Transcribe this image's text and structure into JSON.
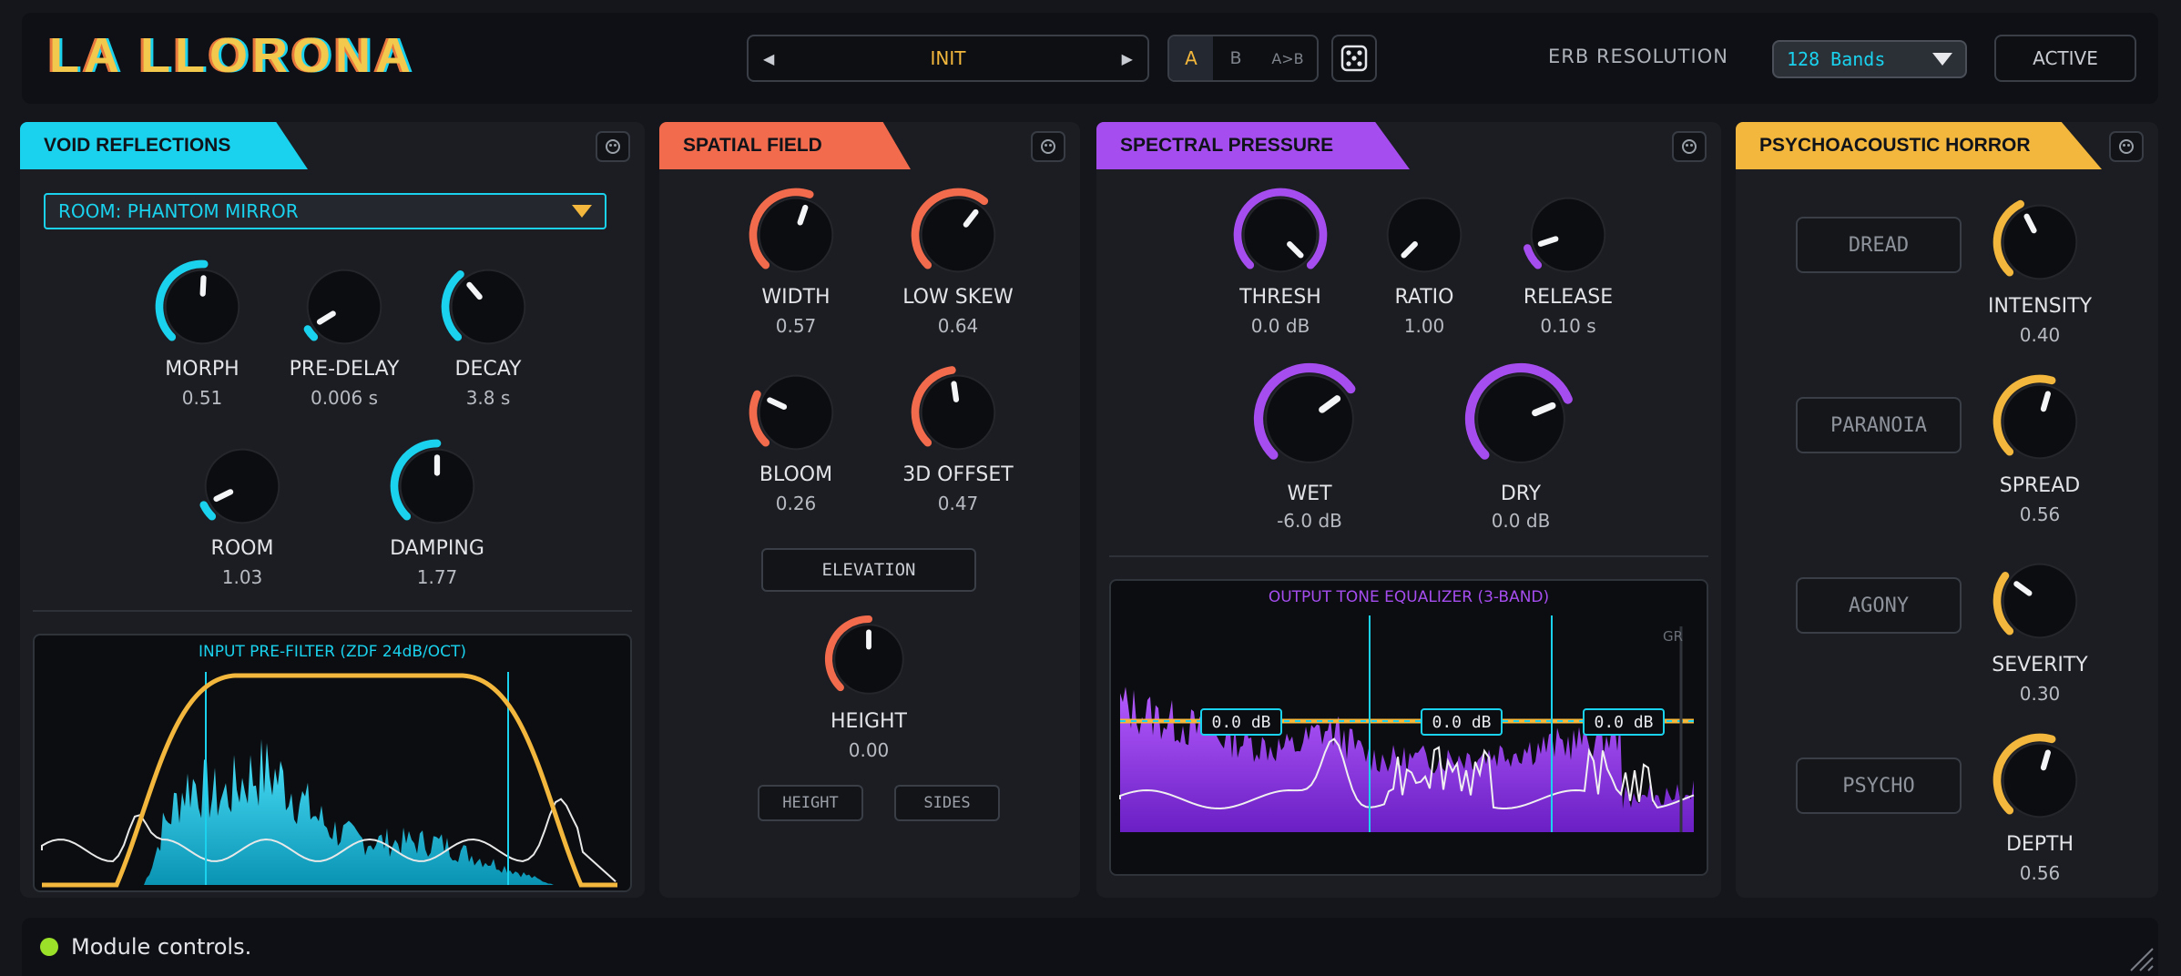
{
  "header": {
    "title": "LA LLORONA",
    "preset": {
      "prev": "◀",
      "name": "INIT",
      "next": "▶"
    },
    "ab": {
      "a": "A",
      "b": "B",
      "copy": "A>B",
      "selected": "A"
    },
    "erb_label": "ERB RESOLUTION",
    "erb_value": "128 Bands",
    "active_label": "ACTIVE"
  },
  "void": {
    "title": "VOID REFLECTIONS",
    "color": "#1ad2ee",
    "room_select": "ROOM: PHANTOM MIRROR",
    "knobs": [
      {
        "label": "MORPH",
        "value": "0.51",
        "level": 0.51
      },
      {
        "label": "PRE-DELAY",
        "value": "0.006 s",
        "level": 0.05
      },
      {
        "label": "DECAY",
        "value": "3.8 s",
        "level": 0.35
      },
      {
        "label": "ROOM",
        "value": "1.03",
        "level": 0.07
      },
      {
        "label": "DAMPING",
        "value": "1.77",
        "level": 0.5
      }
    ],
    "graph_title": "INPUT PRE-FILTER (ZDF 24dB/OCT)"
  },
  "spatial": {
    "title": "SPATIAL FIELD",
    "color": "#f26b4c",
    "knobs": [
      {
        "label": "WIDTH",
        "value": "0.57",
        "level": 0.57
      },
      {
        "label": "LOW SKEW",
        "value": "0.64",
        "level": 0.64
      },
      {
        "label": "BLOOM",
        "value": "0.26",
        "level": 0.26
      },
      {
        "label": "3D OFFSET",
        "value": "0.47",
        "level": 0.47
      }
    ],
    "elevation": "ELEVATION",
    "height_knob": {
      "label": "HEIGHT",
      "value": "0.00",
      "level": 0.5
    },
    "height_btn": "HEIGHT",
    "sides_btn": "SIDES"
  },
  "spectral": {
    "title": "SPECTRAL PRESSURE",
    "color": "#a64df0",
    "knobs": [
      {
        "label": "THRESH",
        "value": "0.0 dB",
        "level": 1.0
      },
      {
        "label": "RATIO",
        "value": "1.00",
        "level": 0.0
      },
      {
        "label": "RELEASE",
        "value": "0.10 s",
        "level": 0.1
      }
    ],
    "big_knobs": [
      {
        "label": "WET",
        "value": "-6.0 dB",
        "level": 0.7
      },
      {
        "label": "DRY",
        "value": "0.0 dB",
        "level": 0.75
      }
    ],
    "graph_title": "OUTPUT TONE EQUALIZER (3-BAND)",
    "gr_label": "GR",
    "bands": [
      "0.0 dB",
      "0.0 dB",
      "0.0 dB"
    ]
  },
  "horror": {
    "title": "PSYCHOACOUSTIC HORROR",
    "color": "#f2b73c",
    "rows": [
      {
        "button": "DREAD",
        "label": "INTENSITY",
        "value": "0.40",
        "level": 0.4
      },
      {
        "button": "PARANOIA",
        "label": "SPREAD",
        "value": "0.56",
        "level": 0.56
      },
      {
        "button": "AGONY",
        "label": "SEVERITY",
        "value": "0.30",
        "level": 0.3
      },
      {
        "button": "PSYCHO",
        "label": "DEPTH",
        "value": "0.56",
        "level": 0.56
      }
    ]
  },
  "status": {
    "text": "Module controls.",
    "led_color": "#9be12a"
  }
}
